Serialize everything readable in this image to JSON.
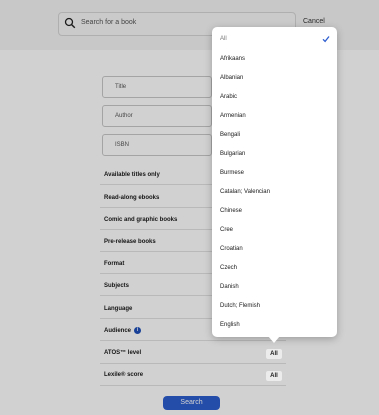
{
  "search": {
    "placeholder": "Search for a book",
    "cancel_label": "Cancel"
  },
  "fields": [
    {
      "label": "Title"
    },
    {
      "label": "Author"
    },
    {
      "label": "ISBN"
    }
  ],
  "filters": [
    {
      "label": "Available titles only",
      "value": ""
    },
    {
      "label": "Read-along ebooks",
      "value": ""
    },
    {
      "label": "Comic and graphic books",
      "value": ""
    },
    {
      "label": "Pre-release books",
      "value": ""
    },
    {
      "label": "Format",
      "value": ""
    },
    {
      "label": "Subjects",
      "value": ""
    },
    {
      "label": "Language",
      "value": ""
    },
    {
      "label": "Audience",
      "value": ""
    },
    {
      "label": "ATOS™ level",
      "value": "All"
    },
    {
      "label": "Lexile® score",
      "value": "All"
    }
  ],
  "search_button_label": "Search",
  "language_dropdown": {
    "selected": "All",
    "items": [
      "All",
      "Afrikaans",
      "Albanian",
      "Arabic",
      "Armenian",
      "Bengali",
      "Bulgarian",
      "Burmese",
      "Catalan; Valencian",
      "Chinese",
      "Cree",
      "Croatian",
      "Czech",
      "Danish",
      "Dutch; Flemish",
      "English"
    ]
  },
  "colors": {
    "accent": "#2d5ecf",
    "info": "#1e4fb9"
  }
}
